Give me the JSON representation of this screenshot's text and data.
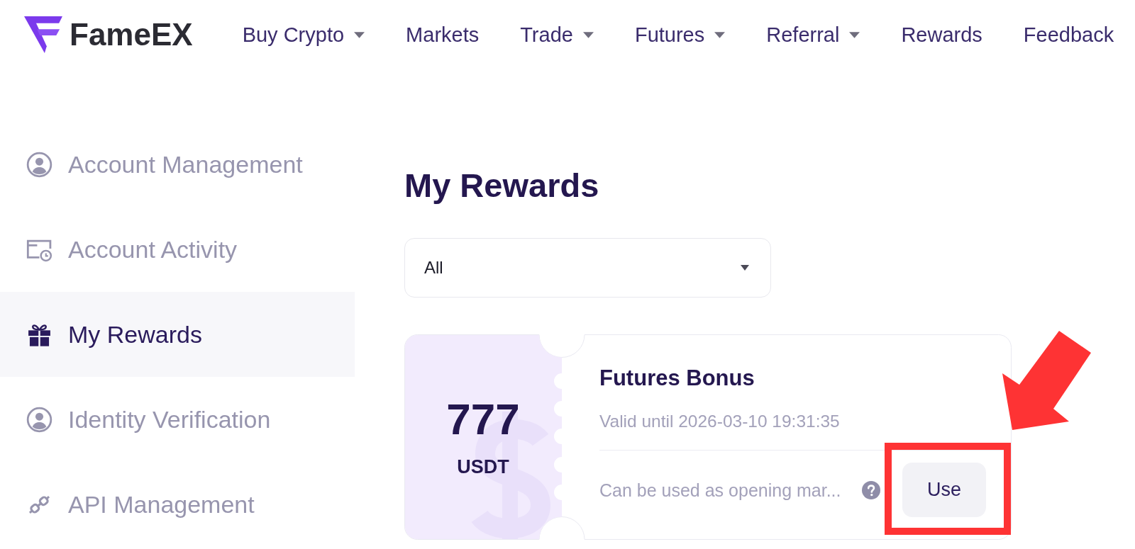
{
  "header": {
    "brand": "FameEX",
    "nav": [
      {
        "label": "Buy Crypto",
        "has_menu": true
      },
      {
        "label": "Markets",
        "has_menu": false
      },
      {
        "label": "Trade",
        "has_menu": true
      },
      {
        "label": "Futures",
        "has_menu": true
      },
      {
        "label": "Referral",
        "has_menu": true
      },
      {
        "label": "Rewards",
        "has_menu": false
      },
      {
        "label": "Feedback",
        "has_menu": false
      }
    ]
  },
  "sidebar": {
    "items": [
      {
        "label": "Account Management",
        "selected": false
      },
      {
        "label": "Account Activity",
        "selected": false
      },
      {
        "label": "My Rewards",
        "selected": true
      },
      {
        "label": "Identity Verification",
        "selected": false
      },
      {
        "label": "API Management",
        "selected": false
      }
    ]
  },
  "main": {
    "title": "My Rewards",
    "filter": {
      "value": "All"
    },
    "rewards": [
      {
        "amount": "777",
        "currency": "USDT",
        "title": "Futures Bonus",
        "validity": "Valid until 2026-03-10 19:31:35",
        "description": "Can be used as opening mar...",
        "button": "Use"
      }
    ]
  }
}
